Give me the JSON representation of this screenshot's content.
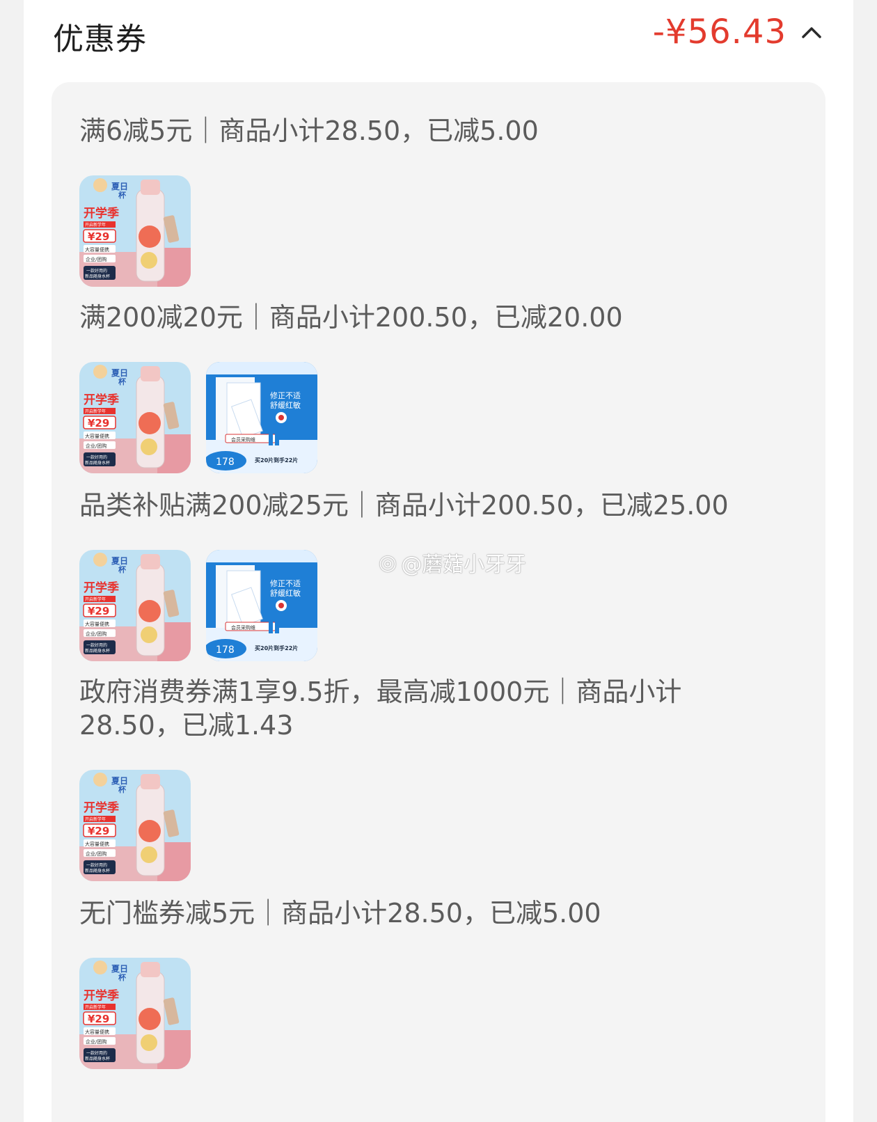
{
  "header": {
    "title": "优惠券",
    "amount": "-¥56.43",
    "toggle_icon": "chevron-up-icon"
  },
  "groups": [
    {
      "title": "满6减5元｜商品小计28.50，已减5.00",
      "products": [
        "bottle"
      ]
    },
    {
      "title": "满200减20元｜商品小计200.50，已减20.00",
      "products": [
        "bottle",
        "mask"
      ]
    },
    {
      "title": "品类补贴满200减25元｜商品小计200.50，已减25.00",
      "products": [
        "bottle",
        "mask"
      ]
    },
    {
      "title": "政府消费券满1享9.5折，最高减1000元｜商品小计28.50，已减1.43",
      "products": [
        "bottle"
      ]
    },
    {
      "title": "无门槛券减5元｜商品小计28.50，已减5.00",
      "products": [
        "bottle"
      ]
    }
  ],
  "products": {
    "bottle": {
      "label_top": "夏日",
      "label_top2": "杯",
      "label_season": "开学季",
      "label_sub": "开启新学年",
      "price": "29",
      "tag1": "大容量便携",
      "tag2": "企业/团购",
      "tag3": "一款好用的",
      "tag4": "新品随身水杯"
    },
    "mask": {
      "headline": "修正不适",
      "headline2": "舒缓红敏",
      "badge": "会员采购维",
      "price": "178",
      "promo": "买20片到手22片"
    }
  },
  "watermark": "@蘑菇小牙牙",
  "colors": {
    "accent": "#e33b2e",
    "panel": "#f4f4f4",
    "text": "#5b5b5b"
  }
}
